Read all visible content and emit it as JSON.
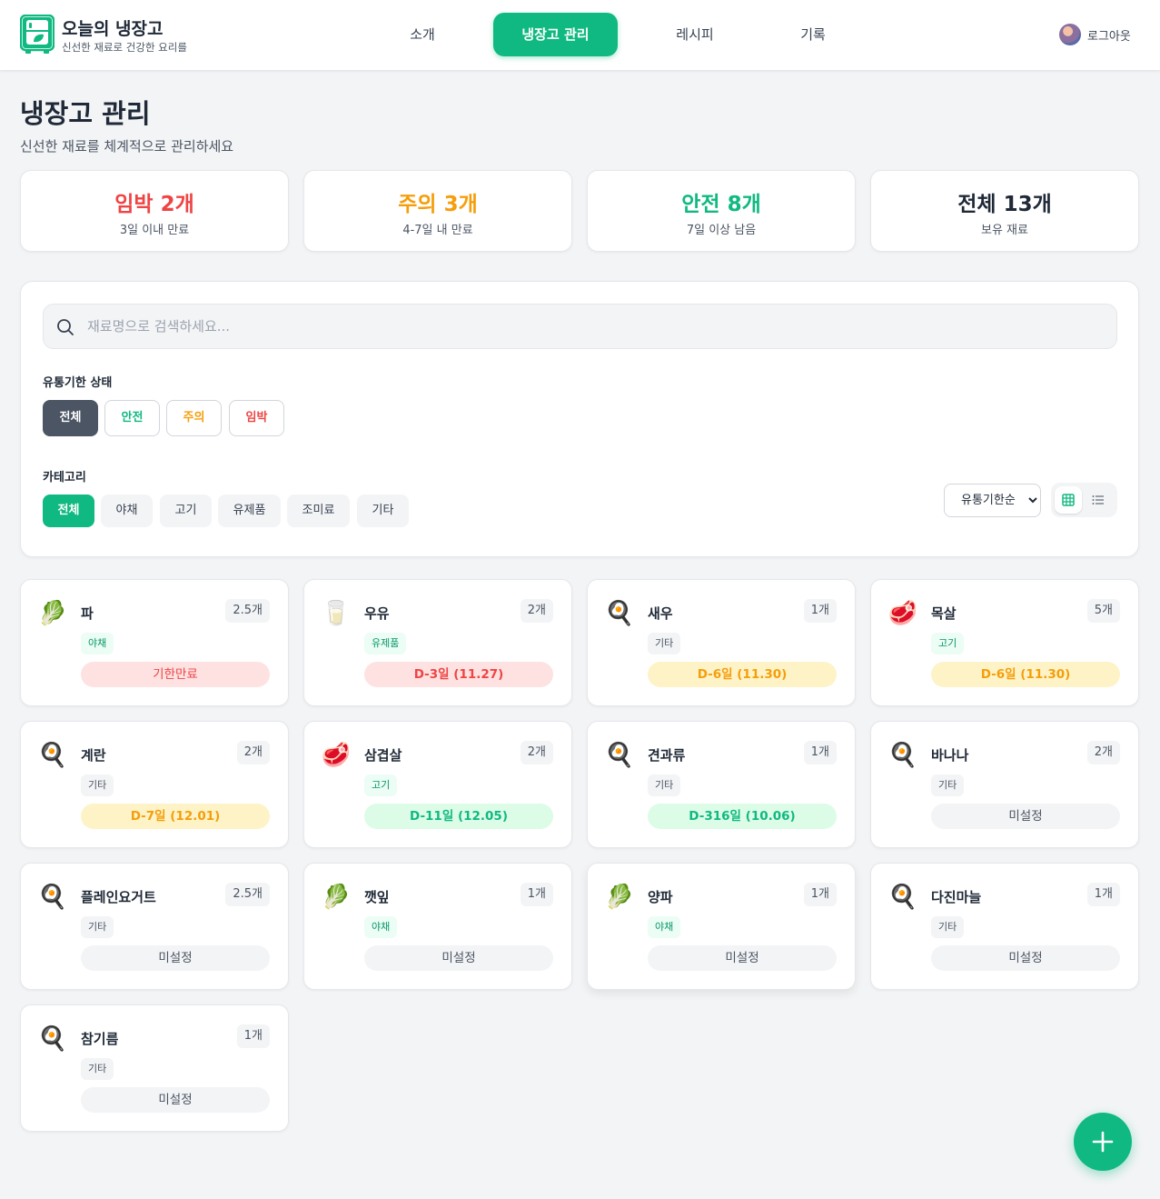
{
  "header": {
    "brand_title": "오늘의 냉장고",
    "brand_subtitle": "신선한 재료로 건강한 요리를",
    "nav": [
      "소개",
      "냉장고 관리",
      "레시피",
      "기록"
    ],
    "active_nav": "냉장고 관리",
    "logout": "로그아웃"
  },
  "page": {
    "title": "냉장고 관리",
    "subtitle": "신선한 재료를 체계적으로 관리하세요"
  },
  "stats": [
    {
      "main": "임박 2개",
      "desc": "3일 이내 만료",
      "color": "#ef4444"
    },
    {
      "main": "주의 3개",
      "desc": "4-7일 내 만료",
      "color": "#f59e0b"
    },
    {
      "main": "안전 8개",
      "desc": "7일 이상 남음",
      "color": "#10b981"
    },
    {
      "main": "전체 13개",
      "desc": "보유 재료",
      "color": "#1f2937"
    }
  ],
  "filters": {
    "search_placeholder": "재료명으로 검색하세요...",
    "status_label": "유통기한 상태",
    "status_chips": [
      "전체",
      "안전",
      "주의",
      "임박"
    ],
    "category_label": "카테고리",
    "category_chips": [
      "전체",
      "야채",
      "고기",
      "유제품",
      "조미료",
      "기타"
    ],
    "sort_selected": "유통기한순",
    "view_mode": "grid"
  },
  "items": [
    {
      "name": "파",
      "qty": "2.5개",
      "category": "야채",
      "icon": "leafy-green-icon",
      "expiry": "기한만료",
      "status": "expired"
    },
    {
      "name": "우유",
      "qty": "2개",
      "category": "유제품",
      "icon": "milk-glass-icon",
      "expiry": "D-3일 (11.27)",
      "status": "urgent"
    },
    {
      "name": "새우",
      "qty": "1개",
      "category": "기타",
      "icon": "frying-pan-icon",
      "expiry": "D-6일 (11.30)",
      "status": "caution"
    },
    {
      "name": "목살",
      "qty": "5개",
      "category": "고기",
      "icon": "meat-icon",
      "expiry": "D-6일 (11.30)",
      "status": "caution"
    },
    {
      "name": "계란",
      "qty": "2개",
      "category": "기타",
      "icon": "frying-pan-icon",
      "expiry": "D-7일 (12.01)",
      "status": "caution"
    },
    {
      "name": "삼겹살",
      "qty": "2개",
      "category": "고기",
      "icon": "meat-icon",
      "expiry": "D-11일 (12.05)",
      "status": "safe"
    },
    {
      "name": "견과류",
      "qty": "1개",
      "category": "기타",
      "icon": "frying-pan-icon",
      "expiry": "D-316일 (10.06)",
      "status": "safe"
    },
    {
      "name": "바나나",
      "qty": "2개",
      "category": "기타",
      "icon": "frying-pan-icon",
      "expiry": "미설정",
      "status": "unset"
    },
    {
      "name": "플레인요거트",
      "qty": "2.5개",
      "category": "기타",
      "icon": "frying-pan-icon",
      "expiry": "미설정",
      "status": "unset"
    },
    {
      "name": "깻잎",
      "qty": "1개",
      "category": "야채",
      "icon": "leafy-green-icon",
      "expiry": "미설정",
      "status": "unset"
    },
    {
      "name": "양파",
      "qty": "1개",
      "category": "야채",
      "icon": "leafy-green-icon",
      "expiry": "미설정",
      "status": "unset"
    },
    {
      "name": "다진마늘",
      "qty": "1개",
      "category": "기타",
      "icon": "frying-pan-icon",
      "expiry": "미설정",
      "status": "unset"
    },
    {
      "name": "참기름",
      "qty": "1개",
      "category": "기타",
      "icon": "frying-pan-icon",
      "expiry": "미설정",
      "status": "unset"
    }
  ],
  "fab_icon": "plus-icon",
  "accent": "#10b981"
}
